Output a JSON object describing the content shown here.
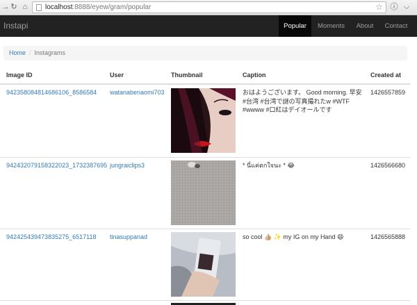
{
  "browser": {
    "url_host": "localhost",
    "url_path": ":8888/eyew/gram/popular"
  },
  "navbar": {
    "brand": "Instapi",
    "links": [
      {
        "label": "Popular",
        "active": true
      },
      {
        "label": "Moments",
        "active": false
      },
      {
        "label": "About",
        "active": false
      },
      {
        "label": "Contact",
        "active": false
      }
    ]
  },
  "breadcrumb": {
    "home": "Home",
    "separator": "/",
    "current": "Instagrams"
  },
  "table": {
    "headers": [
      "Image ID",
      "User",
      "Thumbnail",
      "Caption",
      "Created at"
    ],
    "rows": [
      {
        "image_id": "942358084814686106_8586584",
        "user": "watanabenaomi703",
        "caption": "おはようございます。 Good morning. 早安 #台湾 #台湾で謎の写真撮れたw #WTF #wwww #口紅はデイオールです",
        "created_at": "1426557859"
      },
      {
        "image_id": "942432079158322023_1732387695",
        "user": "jungraiclips3",
        "caption": "* นี่แค่ตกใจนะ * 😂",
        "created_at": "1426566680"
      },
      {
        "image_id": "942425439473835275_6517118",
        "user": "tinasuppanad",
        "caption": "so cool 👍🏼 ✨ my IG on my Hand 😄",
        "created_at": "1426565888"
      }
    ]
  },
  "colors": {
    "navbar_bg": "#222222",
    "link": "#337ab7",
    "lips": "#c8151d"
  }
}
